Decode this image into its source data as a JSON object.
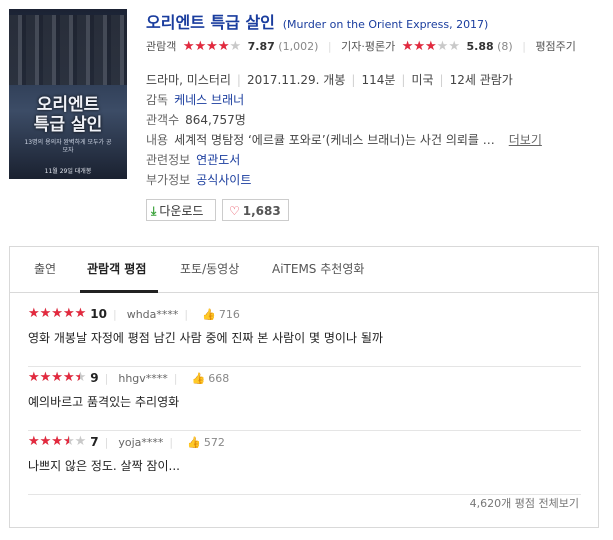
{
  "movie": {
    "title_ko": "오리엔트 특급 살인",
    "title_en": "(Murder on the Orient Express, 2017)",
    "poster": {
      "title_line1": "오리엔트",
      "title_line2": "특급 살인",
      "caption": "13명의 용의자 완벽하게 모두가 공모자",
      "date": "11월 29일 대개봉"
    }
  },
  "ratings": {
    "audience_label": "관람객",
    "audience_score": "7.87",
    "audience_score_value": 7.87,
    "audience_count": "(1,002)",
    "critic_label": "기자·평론가",
    "critic_score": "5.88",
    "critic_score_value": 5.88,
    "critic_count": "(8)",
    "rate_label": "평점주기"
  },
  "info": {
    "genre": "드라마, 미스터리",
    "release": "2017.11.29. 개봉",
    "runtime": "114분",
    "country": "미국",
    "age": "12세 관람가",
    "director_label": "감독",
    "director": "케네스 브래너",
    "audience_count_label": "관객수",
    "audience_count": "864,757명",
    "content_label": "내용",
    "content": "세계적 명탐정 ‘에르큘 포와로’(케네스 브래너)는 사건 의뢰를 …",
    "more": "더보기",
    "related_label": "관련정보",
    "related": "연관도서",
    "extra_label": "부가정보",
    "extra": "공식사이트"
  },
  "buttons": {
    "download_icon": "download-arrow-icon",
    "download": "다운로드",
    "like_icon": "heart-icon",
    "like_count": "1,683"
  },
  "tabs": [
    "출연",
    "관람객 평점",
    "포토/동영상",
    "AiTEMS 추천영화"
  ],
  "active_tab": "관람객 평점",
  "reviews": [
    {
      "score": "10",
      "score_value": 10,
      "user": "whda****",
      "likes": "716",
      "text": "영화 개봉날 자정에 평점 남긴 사람 중에 진짜 본 사람이 몇 명이나 될까"
    },
    {
      "score": "9",
      "score_value": 9,
      "user": "hhgv****",
      "likes": "668",
      "text": "예의바르고 품격있는 추리영화"
    },
    {
      "score": "7",
      "score_value": 7,
      "user": "yoja****",
      "likes": "572",
      "text": "나쁘지 않은 정도. 살짝 잠이..."
    }
  ],
  "all_reviews": "4,620개 평점 전체보기",
  "colors": {
    "title": "#1a3d9e",
    "star": "#e3293e",
    "download": "#3aa23a"
  }
}
